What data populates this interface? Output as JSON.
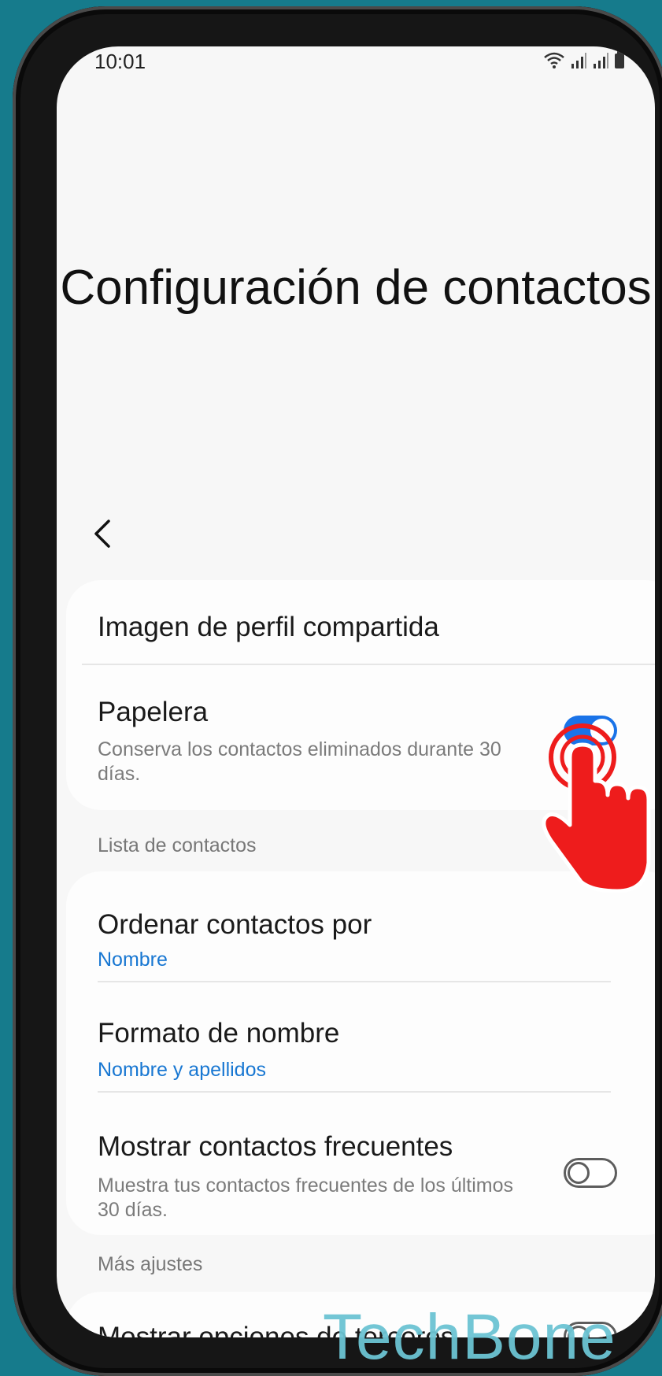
{
  "status_bar": {
    "time": "10:01"
  },
  "page": {
    "title": "Configuración de contactos"
  },
  "settings": {
    "shared_profile_image": {
      "label": "Imagen de perfil compartida"
    },
    "trash": {
      "label": "Papelera",
      "description": "Conserva los contactos eliminados durante 30 días.",
      "enabled": true
    }
  },
  "contact_list": {
    "header": "Lista de contactos",
    "sort_by": {
      "label": "Ordenar contactos por",
      "value": "Nombre"
    },
    "name_format": {
      "label": "Formato de nombre",
      "value": "Nombre y apellidos"
    },
    "frequent": {
      "label": "Mostrar contactos frecuentes",
      "description": "Muestra tus contactos frecuentes de los últimos 30 días.",
      "enabled": false
    }
  },
  "more_settings": {
    "header": "Más ajustes",
    "third_party": {
      "label": "Mostrar opciones de terceros",
      "enabled": false
    }
  },
  "watermark": "TechBone",
  "colors": {
    "accent": "#1a73e8",
    "link": "#1877d2",
    "frame_bg": "#167b8c",
    "tap_hand": "#ee1c1c"
  }
}
